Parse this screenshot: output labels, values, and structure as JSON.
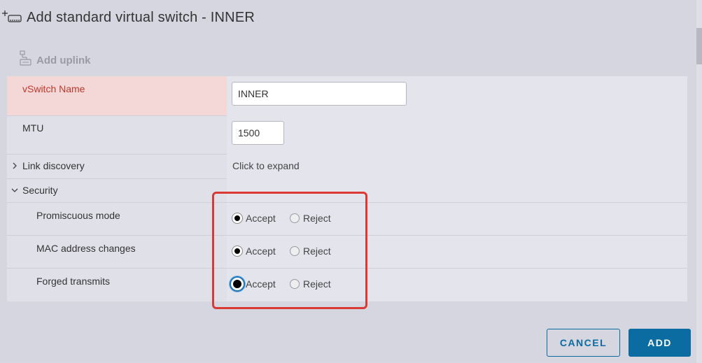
{
  "dialog": {
    "title": "Add standard virtual switch - INNER",
    "title_icon": "add-switch-icon"
  },
  "toolbar": {
    "add_uplink_label": "Add uplink",
    "add_uplink_icon": "uplink-icon"
  },
  "form": {
    "vswitch_name": {
      "label": "vSwitch Name",
      "value": "INNER"
    },
    "mtu": {
      "label": "MTU",
      "value": "1500"
    },
    "link_discovery": {
      "label": "Link discovery",
      "value": "Click to expand",
      "expanded": false
    },
    "security": {
      "label": "Security",
      "expanded": true,
      "rows": [
        {
          "label": "Promiscuous mode",
          "accept": "Accept",
          "reject": "Reject",
          "selected": "Accept"
        },
        {
          "label": "MAC address changes",
          "accept": "Accept",
          "reject": "Reject",
          "selected": "Accept"
        },
        {
          "label": "Forged transmits",
          "accept": "Accept",
          "reject": "Reject",
          "selected": "Accept"
        }
      ]
    }
  },
  "buttons": {
    "cancel": "CANCEL",
    "add": "ADD"
  },
  "colors": {
    "accent": "#0a6ca0",
    "error_label": "#c0392b",
    "error_bg": "#f4d7d7",
    "highlight_border": "#d93a35"
  }
}
